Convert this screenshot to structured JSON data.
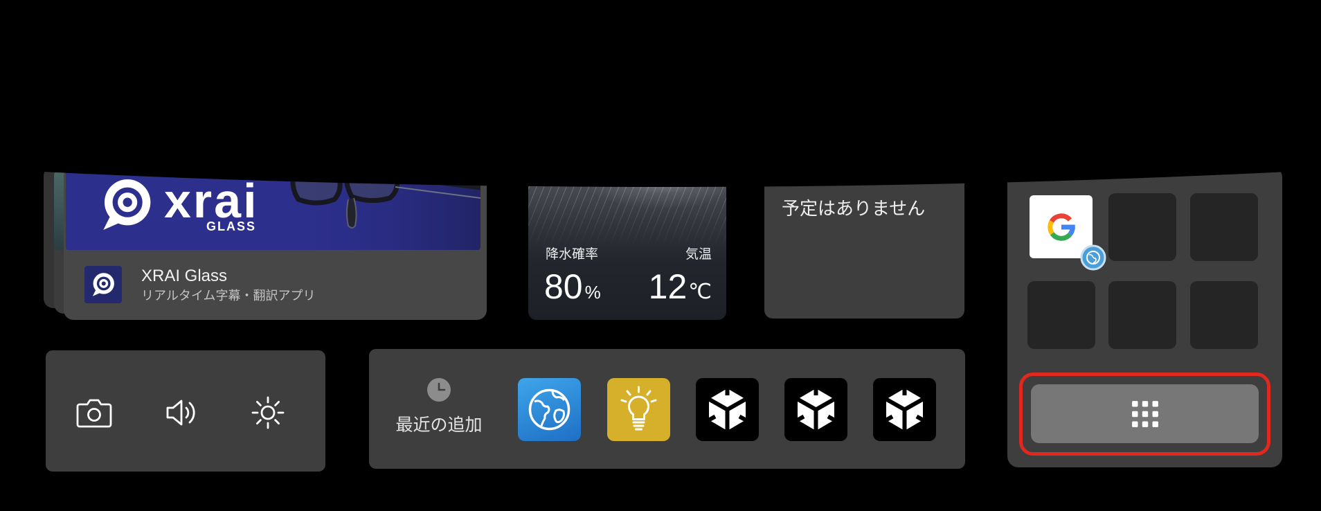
{
  "xrai_card": {
    "banner": {
      "logo_text": "xrai",
      "logo_subtext": "GLASS",
      "logo_icon": "xrai-logo-icon",
      "background": "#2c2f8c"
    },
    "app_icon": "xrai-logo-icon",
    "app_name": "XRAI Glass",
    "app_description": "リアルタイム字幕・翻訳アプリ"
  },
  "weather": {
    "background_icon": "rain-image",
    "precip_label": "降水確率",
    "precip_value": "80",
    "precip_unit": "%",
    "temp_label": "気温",
    "temp_value": "12",
    "temp_unit": "℃"
  },
  "calendar": {
    "empty_message": "予定はありません"
  },
  "app_grid": {
    "tiles": [
      {
        "icon": "google-icon",
        "badge": "globe-badge-icon"
      },
      {
        "icon": "empty-tile"
      },
      {
        "icon": "empty-tile"
      },
      {
        "icon": "empty-tile"
      },
      {
        "icon": "empty-tile"
      },
      {
        "icon": "empty-tile"
      }
    ],
    "all_apps_button": {
      "icon": "grid-dots-icon",
      "color": "#777777"
    },
    "highlight_color": "#e0281e"
  },
  "quick_settings": {
    "items": [
      {
        "icon": "camera-icon"
      },
      {
        "icon": "volume-icon"
      },
      {
        "icon": "brightness-icon"
      }
    ]
  },
  "recent": {
    "icon": "clock-icon",
    "label": "最近の追加",
    "apps": [
      {
        "icon": "globe-icon",
        "color": "#2f8ad8"
      },
      {
        "icon": "lightbulb-icon",
        "color": "#d6b02a"
      },
      {
        "icon": "unity-icon",
        "color": "#000000"
      },
      {
        "icon": "unity-icon",
        "color": "#000000"
      },
      {
        "icon": "unity-icon",
        "color": "#000000"
      }
    ]
  },
  "colors": {
    "background": "#000000",
    "card": "#3e3e3e"
  }
}
